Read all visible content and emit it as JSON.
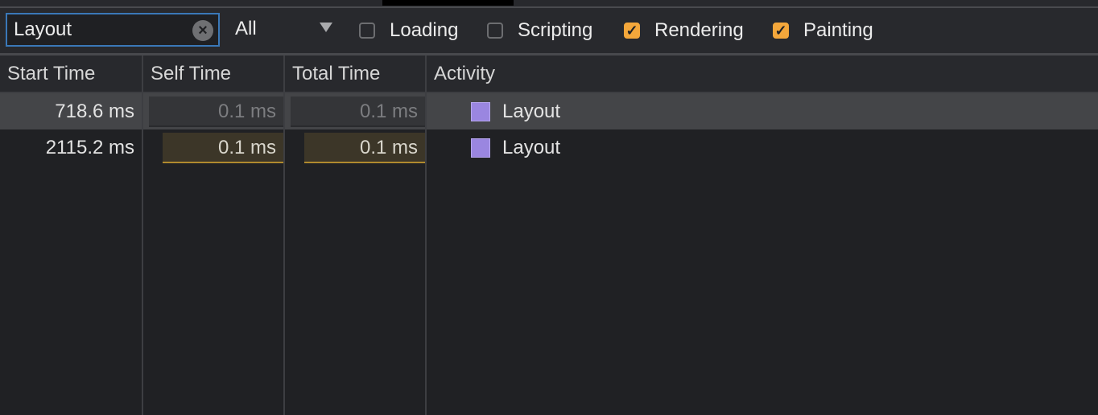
{
  "toolbar": {
    "search_value": "Layout",
    "filter_select": "All",
    "checkboxes": [
      {
        "label": "Loading",
        "checked": false
      },
      {
        "label": "Scripting",
        "checked": false
      },
      {
        "label": "Rendering",
        "checked": true
      },
      {
        "label": "Painting",
        "checked": true
      }
    ]
  },
  "table": {
    "columns": [
      "Start Time",
      "Self Time",
      "Total Time",
      "Activity"
    ],
    "rows": [
      {
        "start": "718.6 ms",
        "self": "0.1 ms",
        "total": "0.1 ms",
        "activity": "Layout",
        "selected": true
      },
      {
        "start": "2115.2 ms",
        "self": "0.1 ms",
        "total": "0.1 ms",
        "activity": "Layout",
        "selected": false
      }
    ]
  },
  "colors": {
    "accent_checkbox": "#f4a73b",
    "layout_swatch": "#9a86e0",
    "focus_border": "#3a78b8"
  }
}
